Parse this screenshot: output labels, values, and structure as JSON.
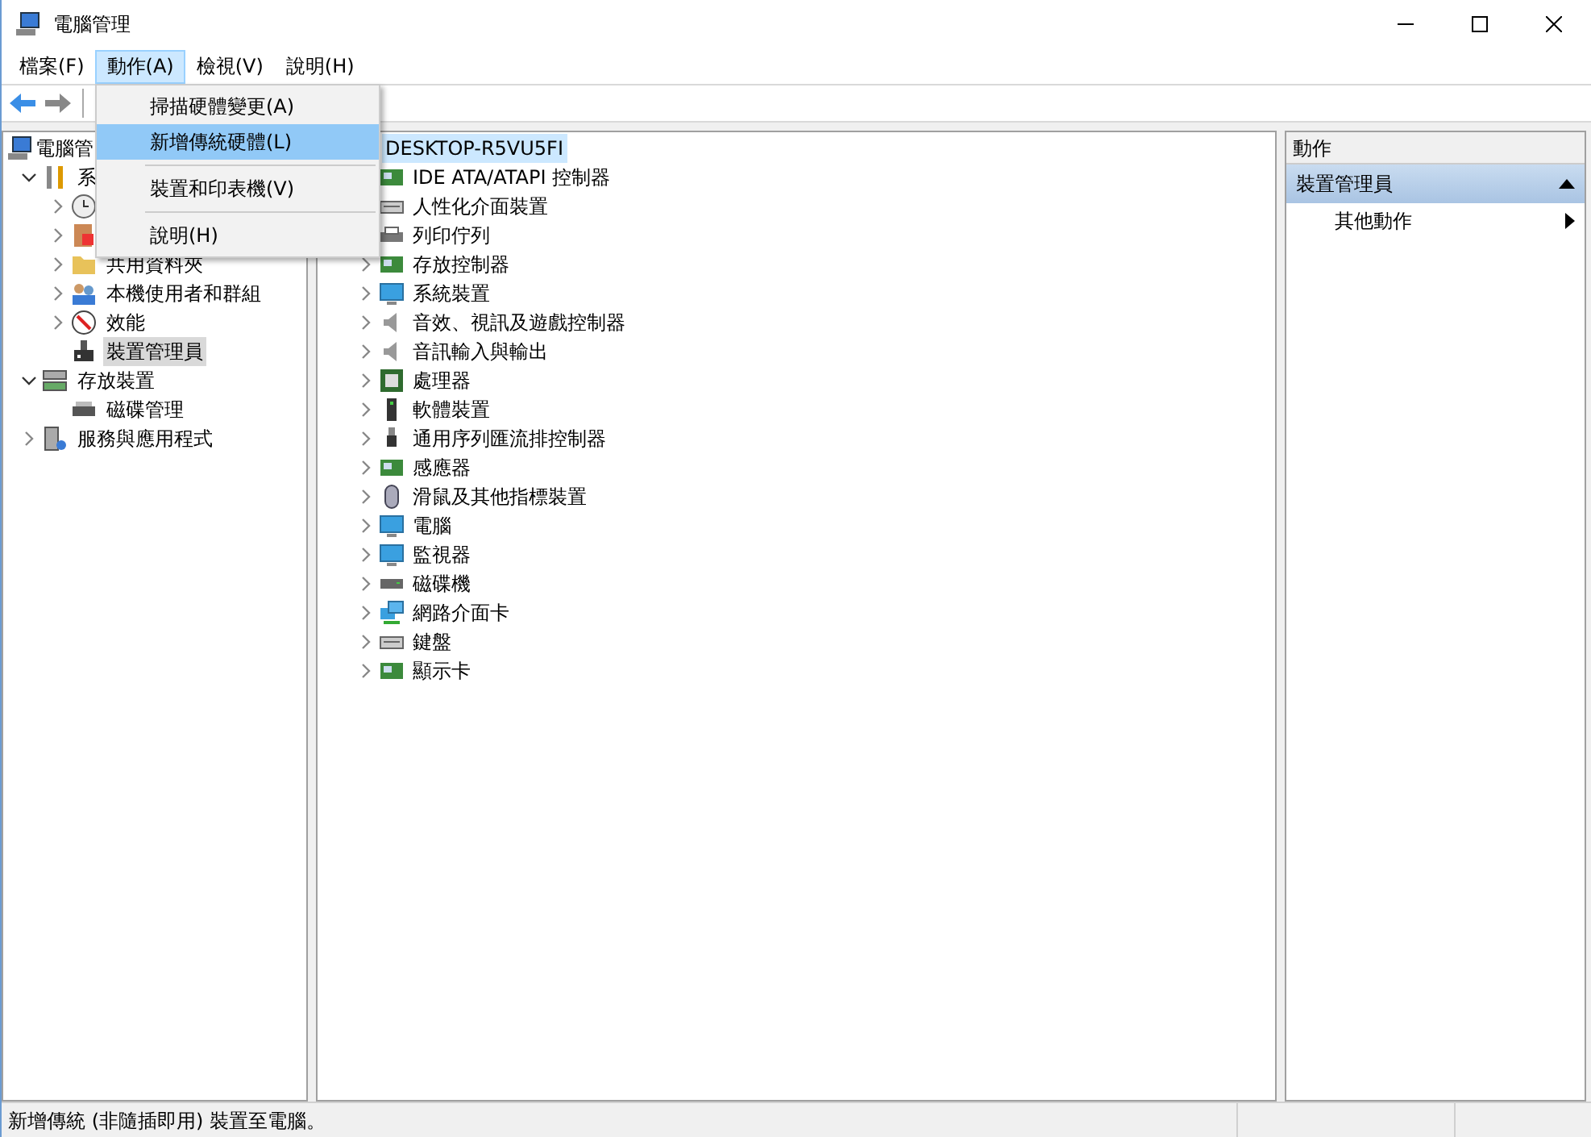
{
  "window": {
    "title": "電腦管理"
  },
  "menu_bar": [
    {
      "label": "檔案(F)",
      "selected": false
    },
    {
      "label": "動作(A)",
      "selected": true
    },
    {
      "label": "檢視(V)",
      "selected": false
    },
    {
      "label": "說明(H)",
      "selected": false
    }
  ],
  "dropdown": [
    {
      "kind": "item",
      "label": "掃描硬體變更(A)",
      "selected": false
    },
    {
      "kind": "item",
      "label": "新增傳統硬體(L)",
      "selected": true
    },
    {
      "kind": "separator"
    },
    {
      "kind": "item",
      "label": "裝置和印表機(V)",
      "selected": false
    },
    {
      "kind": "separator"
    },
    {
      "kind": "item",
      "label": "說明(H)",
      "selected": false
    }
  ],
  "left_tree": [
    {
      "label": "電腦管",
      "children": [
        {
          "label": "系",
          "expanded": true,
          "children": [
            {
              "expanded": false
            },
            {
              "expanded": false
            },
            {
              "label": "共用資料夾",
              "expanded": false,
              "selected": false
            },
            {
              "label": "本機使用者和群組",
              "expanded": false,
              "selected": false
            },
            {
              "label": "效能",
              "expanded": false,
              "selected": false
            },
            {
              "label": "裝置管理員",
              "selected": true
            }
          ]
        },
        {
          "label": "存放裝置",
          "expanded": true,
          "selected": false,
          "children": [
            {
              "label": "磁碟管理",
              "selected": false
            }
          ]
        },
        {
          "label": "服務與應用程式",
          "expanded": false,
          "selected": false
        }
      ]
    }
  ],
  "device_tree": {
    "root": {
      "label": "DESKTOP-R5VU5FI",
      "selected": true
    },
    "children": [
      {
        "label": "IDE ATA/ATAPI 控制器"
      },
      {
        "label": "人性化介面裝置"
      },
      {
        "label": "列印佇列"
      },
      {
        "label": "存放控制器",
        "expanded": false
      },
      {
        "label": "系統裝置",
        "expanded": false
      },
      {
        "label": "音效、視訊及遊戲控制器",
        "expanded": false
      },
      {
        "label": "音訊輸入與輸出",
        "expanded": false
      },
      {
        "label": "處理器",
        "expanded": false
      },
      {
        "label": "軟體裝置",
        "expanded": false
      },
      {
        "label": "通用序列匯流排控制器",
        "expanded": false
      },
      {
        "label": "感應器",
        "expanded": false
      },
      {
        "label": "滑鼠及其他指標裝置",
        "expanded": false
      },
      {
        "label": "電腦",
        "expanded": false
      },
      {
        "label": "監視器",
        "expanded": false
      },
      {
        "label": "磁碟機",
        "expanded": false
      },
      {
        "label": "網路介面卡",
        "expanded": false
      },
      {
        "label": "鍵盤",
        "expanded": false
      },
      {
        "label": "顯示卡",
        "expanded": false
      }
    ]
  },
  "actions_pane": {
    "header": "動作",
    "section": {
      "label": "裝置管理員",
      "expanded": true
    },
    "items": [
      {
        "label": "其他動作"
      }
    ]
  },
  "status_bar": {
    "text": "新增傳統 (非隨插即用) 裝置至電腦。"
  }
}
